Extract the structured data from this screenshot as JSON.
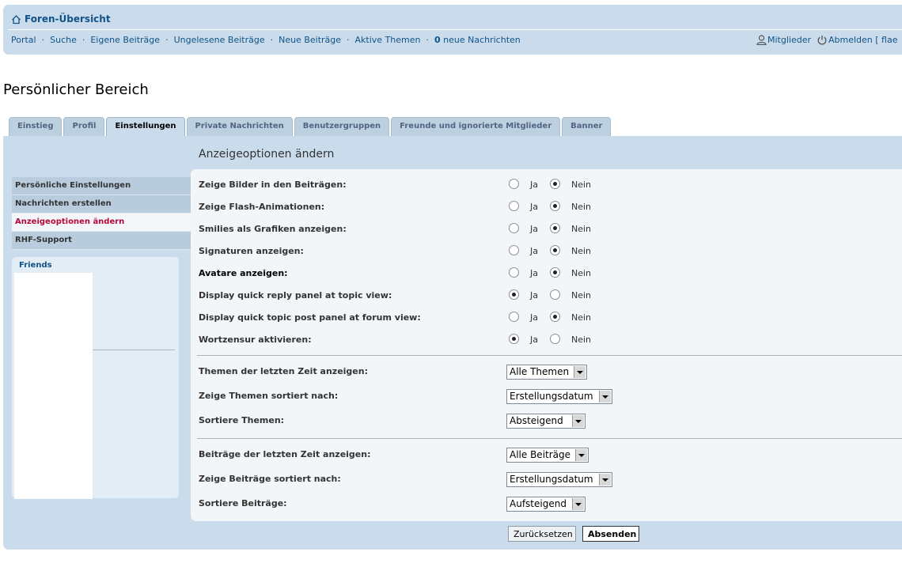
{
  "header": {
    "home_label": "Foren-Übersicht",
    "links": [
      "Portal",
      "Suche",
      "Eigene Beiträge",
      "Ungelesene Beiträge",
      "Neue Beiträge",
      "Aktive Themen"
    ],
    "messages_count": "0",
    "messages_label": "neue Nachrichten",
    "members_label": "Mitglieder",
    "logout_label": "Abmelden [ flae"
  },
  "page_title": "Persönlicher Bereich",
  "tabs": [
    {
      "label": "Einstieg",
      "active": false
    },
    {
      "label": "Profil",
      "active": false
    },
    {
      "label": "Einstellungen",
      "active": true
    },
    {
      "label": "Private Nachrichten",
      "active": false
    },
    {
      "label": "Benutzergruppen",
      "active": false
    },
    {
      "label": "Freunde und ignorierte Mitglieder",
      "active": false
    },
    {
      "label": "Banner",
      "active": false
    }
  ],
  "menu": [
    {
      "label": "Persönliche Einstellungen",
      "active": false
    },
    {
      "label": "Nachrichten erstellen",
      "active": false
    },
    {
      "label": "Anzeigeoptionen ändern",
      "active": true
    },
    {
      "label": "RHF-Support",
      "active": false
    }
  ],
  "friends_label": "Friends",
  "section_title": "Anzeigeoptionen ändern",
  "radio_yes": "Ja",
  "radio_no": "Nein",
  "options": [
    {
      "label": "Zeige Bilder in den Beiträgen:",
      "value": "Nein"
    },
    {
      "label": "Zeige Flash-Animationen:",
      "value": "Nein"
    },
    {
      "label": "Smilies als Grafiken anzeigen:",
      "value": "Nein"
    },
    {
      "label": "Signaturen anzeigen:",
      "value": "Nein"
    },
    {
      "label": "Avatare anzeigen:",
      "value": "Nein"
    },
    {
      "label": "Display quick reply panel at topic view:",
      "value": "Ja"
    },
    {
      "label": "Display quick topic post panel at forum view:",
      "value": "Nein"
    },
    {
      "label": "Wortzensur aktivieren:",
      "value": "Ja"
    }
  ],
  "topic_selects": [
    {
      "label": "Themen der letzten Zeit anzeigen:",
      "value": "Alle Themen"
    },
    {
      "label": "Zeige Themen sortiert nach:",
      "value": "Erstellungsdatum"
    },
    {
      "label": "Sortiere Themen:",
      "value": "Absteigend"
    }
  ],
  "post_selects": [
    {
      "label": "Beiträge der letzten Zeit anzeigen:",
      "value": "Alle Beiträge"
    },
    {
      "label": "Zeige Beiträge sortiert nach:",
      "value": "Erstellungsdatum"
    },
    {
      "label": "Sortiere Beiträge:",
      "value": "Aufsteigend"
    }
  ],
  "buttons": {
    "reset": "Zurücksetzen",
    "submit": "Absenden"
  }
}
